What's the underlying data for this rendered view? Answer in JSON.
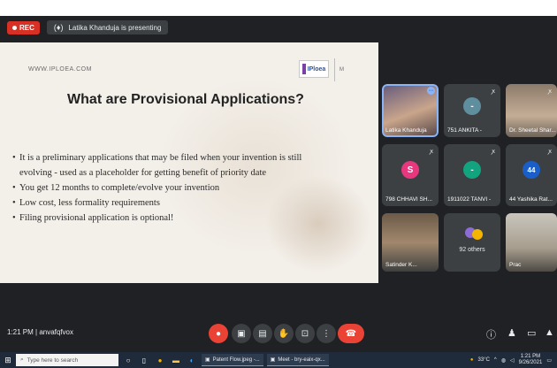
{
  "meet": {
    "rec_label": "REC",
    "presenting_text": "Latika Khanduja is presenting"
  },
  "slide": {
    "url": "WWW.IPLOEA.COM",
    "logo_text": "IPloea",
    "side_text": "M",
    "title": "What are Provisional Applications?",
    "bullets": [
      "It is a preliminary applications that may be filed when your invention is still",
      "evolving - used as a placeholder for getting benefit of priority date",
      "You get 12 months to complete/evolve your invention",
      "Low cost, less formality requirements",
      "Filing provisional application is optional!"
    ]
  },
  "participants": [
    {
      "name": "Latika Khanduja",
      "type": "video"
    },
    {
      "name": "751 ANKITA -",
      "type": "avatar",
      "initial": "-",
      "color": "#5f8f9f"
    },
    {
      "name": "Dr. Sheetal Shar...",
      "type": "video"
    },
    {
      "name": "798 CHHAVI SH...",
      "type": "avatar",
      "initial": "S",
      "color": "#e8377f"
    },
    {
      "name": "1911022 TANVI -",
      "type": "avatar",
      "initial": "-",
      "color": "#12a47f"
    },
    {
      "name": "44 Yashika Rat...",
      "type": "avatar",
      "initial": "44",
      "color": "#1a5fc9"
    },
    {
      "name": "Satinder K...",
      "type": "video"
    },
    {
      "name": "92 others",
      "type": "others"
    },
    {
      "name": "Prac",
      "type": "video"
    }
  ],
  "bottom_bar": {
    "meeting_info": "1:21 PM  |  anvafqfvox"
  },
  "taskbar": {
    "search_placeholder": "Type here to search",
    "app1_label": "Patent Flow.jpeg -...",
    "app2_label": "Meet - bry-eaix-qx...",
    "weather": "33°C",
    "time": "1:21 PM",
    "date": "9/26/2021"
  },
  "colors": {
    "rec_red": "#d93025",
    "hangup_red": "#ea4335",
    "meet_bg": "#202124"
  }
}
